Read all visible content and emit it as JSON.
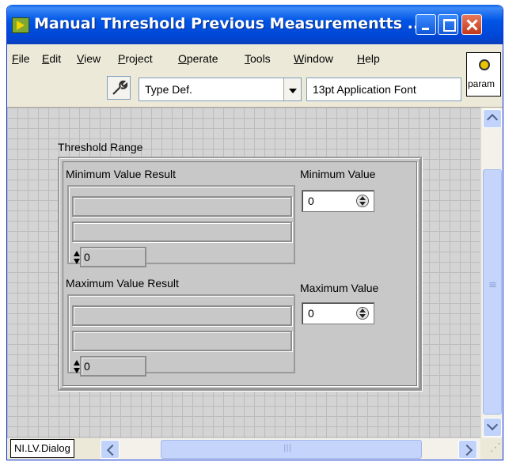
{
  "window": {
    "title": "Manual Threshold Previous Measurementts ..."
  },
  "menu": {
    "items": [
      {
        "label": "File",
        "accel": "F",
        "rest": "ile"
      },
      {
        "label": "Edit",
        "accel": "E",
        "rest": "dit"
      },
      {
        "label": "View",
        "accel": "V",
        "rest": "iew"
      },
      {
        "label": "Project",
        "accel": "P",
        "rest": "roject"
      },
      {
        "label": "Operate",
        "accel": "O",
        "rest": "perate"
      },
      {
        "label": "Tools",
        "accel": "T",
        "rest": "ools"
      },
      {
        "label": "Window",
        "accel": "W",
        "rest": "indow"
      },
      {
        "label": "Help",
        "accel": "H",
        "rest": "elp"
      }
    ]
  },
  "toolbar": {
    "type_def": "Type Def.",
    "font": "13pt Application Font",
    "param_label": "param"
  },
  "panel": {
    "cluster_label": "Threshold Range",
    "min_result_label": "Minimum Value Result",
    "min_index": "0",
    "min_value_label": "Minimum Value",
    "min_value": "0",
    "max_result_label": "Maximum Value Result",
    "max_index": "0",
    "max_value_label": "Maximum Value",
    "max_value": "0"
  },
  "status": {
    "context": "NI.LV.Dialog"
  }
}
